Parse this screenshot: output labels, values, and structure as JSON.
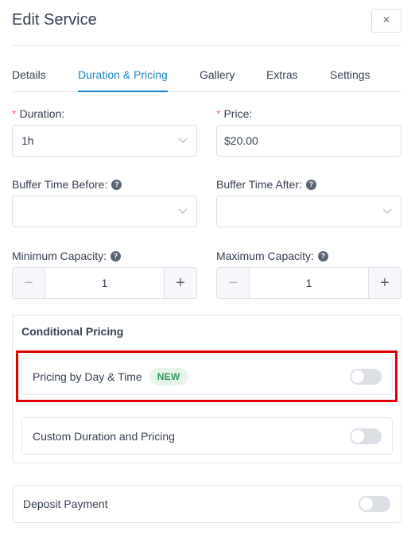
{
  "dialog": {
    "title": "Edit Service",
    "close_glyph": "×"
  },
  "tabs": [
    {
      "label": "Details"
    },
    {
      "label": "Duration & Pricing",
      "active": true
    },
    {
      "label": "Gallery"
    },
    {
      "label": "Extras"
    },
    {
      "label": "Settings"
    }
  ],
  "form": {
    "required_marker": "*",
    "help_glyph": "?",
    "duration": {
      "label": "Duration:",
      "value": "1h"
    },
    "price": {
      "label": "Price:",
      "value": "$20.00"
    },
    "buffer_before": {
      "label": "Buffer Time Before:",
      "value": ""
    },
    "buffer_after": {
      "label": "Buffer Time After:",
      "value": ""
    },
    "min_capacity": {
      "label": "Minimum Capacity:",
      "value": "1"
    },
    "max_capacity": {
      "label": "Maximum Capacity:",
      "value": "1"
    },
    "stepper": {
      "minus": "−",
      "plus": "+"
    }
  },
  "conditional_pricing": {
    "title": "Conditional Pricing",
    "items": [
      {
        "label": "Pricing by Day & Time",
        "badge": "NEW",
        "enabled": false
      },
      {
        "label": "Custom Duration and Pricing",
        "enabled": false
      }
    ]
  },
  "deposit": {
    "label": "Deposit Payment",
    "enabled": false
  },
  "colors": {
    "accent": "#1a84c8",
    "required": "#f56c6c",
    "badge_text": "#2f9a58",
    "badge_bg": "#e6f5ec",
    "highlight": "#e00000"
  },
  "icons": {
    "close": "close-icon",
    "dropdown": "chevron-down-icon",
    "help": "help-circle-icon",
    "minus": "minus-icon",
    "plus": "plus-icon"
  }
}
